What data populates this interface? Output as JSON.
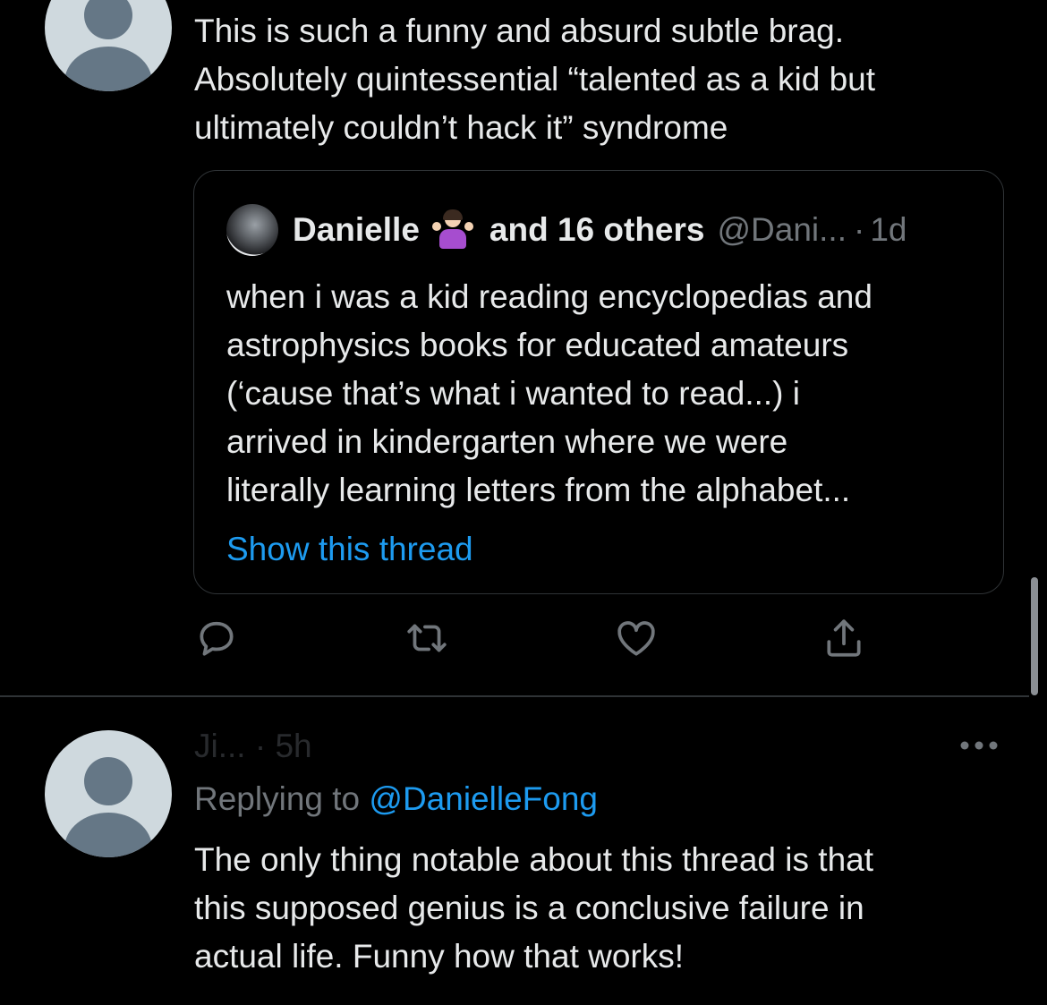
{
  "tweet1": {
    "text_lines": [
      "This is such a funny and absurd subtle brag.",
      "Absolutely quintessential “talented as a kid but",
      "ultimately couldn’t hack it” syndrome"
    ]
  },
  "quote": {
    "name": "Danielle",
    "name_suffix": "and 16 others",
    "handle": "@Dani...",
    "separator": "·",
    "time": "1d",
    "body_lines": [
      "when i was a kid reading encyclopedias and",
      "astrophysics books for educated amateurs",
      "(‘cause that’s what i wanted to read...) i",
      "arrived in kindergarten where we were",
      "literally learning letters from the alphabet..."
    ],
    "show_thread": "Show this thread"
  },
  "actions": {
    "icons": [
      "reply-icon",
      "retweet-icon",
      "like-icon",
      "share-icon"
    ]
  },
  "tweet2": {
    "meta": "Ji... · 5h",
    "replying_label": "Replying to",
    "replying_handle": "@DanielleFong",
    "text_lines": [
      "The only thing notable about this thread is that",
      "this supposed genius is a conclusive failure in",
      "actual life. Funny how that works!"
    ]
  },
  "colors": {
    "background": "#000000",
    "text": "#e7e9ea",
    "muted": "#71767b",
    "link": "#1d9bf0",
    "border": "#2f3336"
  }
}
